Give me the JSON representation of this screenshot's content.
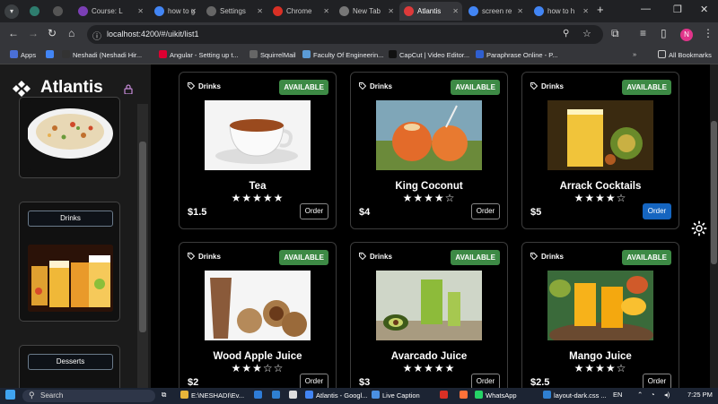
{
  "browser": {
    "tabs": [
      {
        "label": "",
        "icon": "app-icon",
        "color": "#2e7d6e"
      },
      {
        "label": "",
        "icon": "speaker-icon",
        "color": "#555"
      },
      {
        "label": "Course: L",
        "icon": "course-icon",
        "color": "#7b3fb5"
      },
      {
        "label": "how to g",
        "icon": "google-icon",
        "color": "#4285f4"
      },
      {
        "label": "Settings",
        "icon": "gear-icon",
        "color": "#666"
      },
      {
        "label": "Chrome",
        "icon": "chrome-icon",
        "color": "#d93025"
      },
      {
        "label": "New Tab",
        "icon": "chrome-icon",
        "color": "#777"
      },
      {
        "label": "Atlantis",
        "icon": "angular-icon",
        "color": "#dd3a3a"
      },
      {
        "label": "screen re",
        "icon": "google-icon",
        "color": "#4285f4"
      },
      {
        "label": "how to h",
        "icon": "google-icon",
        "color": "#4285f4"
      }
    ],
    "url": "localhost:4200/#/uikit/list1",
    "profile_initial": "N",
    "bookmarks": [
      {
        "label": "Apps",
        "color": "#4a6fd6"
      },
      {
        "label": "",
        "color": "#4285f4"
      },
      {
        "label": "Neshadi (Neshadi Hir...",
        "color": "#333"
      },
      {
        "label": "Angular - Setting up t...",
        "color": "#dd0031"
      },
      {
        "label": "SquirrelMail",
        "color": "#666"
      },
      {
        "label": "Faculty Of Engineerin...",
        "color": "#5b9bd5"
      },
      {
        "label": "CapCut | Video Editor...",
        "color": "#111"
      },
      {
        "label": "Paraphrase Online - P...",
        "color": "#2f5fd0"
      }
    ],
    "all_bookmarks": "All Bookmarks"
  },
  "app": {
    "brand": "Atlantis",
    "sidebar_categories": [
      {
        "label": "Drinks"
      },
      {
        "label": "Desserts"
      }
    ]
  },
  "products": [
    {
      "category": "Drinks",
      "status": "AVAILABLE",
      "name": "Tea",
      "rating": 5,
      "price": "$1.5",
      "order": "Order",
      "primary": false
    },
    {
      "category": "Drinks",
      "status": "AVAILABLE",
      "name": "King Coconut",
      "rating": 4,
      "price": "$4",
      "order": "Order",
      "primary": false
    },
    {
      "category": "Drinks",
      "status": "AVAILABLE",
      "name": "Arrack Cocktails",
      "rating": 4,
      "price": "$5",
      "order": "Order",
      "primary": true
    },
    {
      "category": "Drinks",
      "status": "AVAILABLE",
      "name": "Wood Apple Juice",
      "rating": 3,
      "price": "$2",
      "order": "Order",
      "primary": false
    },
    {
      "category": "Drinks",
      "status": "AVAILABLE",
      "name": "Avarcado Juice",
      "rating": 5,
      "price": "$3",
      "order": "Order",
      "primary": false
    },
    {
      "category": "Drinks",
      "status": "AVAILABLE",
      "name": "Mango Juice",
      "rating": 4,
      "price": "$2.5",
      "order": "Order",
      "primary": false
    }
  ],
  "taskbar": {
    "search_label": "Search",
    "items": [
      {
        "label": "E:\\NESHADI\\Ev...",
        "color": "#e8b53a"
      },
      {
        "label": "Atlantis - Googl...",
        "color": "#4285f4"
      },
      {
        "label": "Live Caption",
        "color": "#4a90e2"
      },
      {
        "label": "WhatsApp",
        "color": "#25d366"
      },
      {
        "label": "layout-dark.css ...",
        "color": "#2f80d1"
      }
    ],
    "lang": "EN",
    "time": "7:25 PM"
  }
}
